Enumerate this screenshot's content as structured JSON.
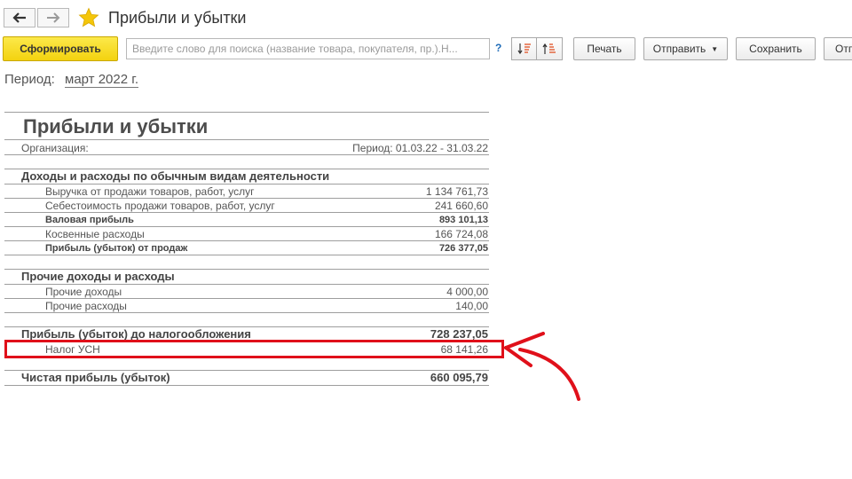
{
  "window": {
    "title": "Прибыли и убытки"
  },
  "toolbar": {
    "generate_label": "Сформировать",
    "search_placeholder": "Введите слово для поиска (название товара, покупателя, пр.).Н...",
    "help_label": "?",
    "print_label": "Печать",
    "send_label": "Отправить",
    "save_label": "Сохранить",
    "more_label": "Отп"
  },
  "period": {
    "label": "Период:",
    "value": "март 2022 г."
  },
  "report": {
    "title": "Прибыли и убытки",
    "org_label": "Организация:",
    "period_text": "Период: 01.03.22 - 31.03.22",
    "rows": [
      {
        "label": "Доходы и расходы по обычным видам деятельности",
        "value": ""
      },
      {
        "label": "Выручка от продажи товаров, работ, услуг",
        "value": "1 134 761,73"
      },
      {
        "label": "Себестоимость продажи товаров, работ, услуг",
        "value": "241 660,60"
      },
      {
        "label": "Валовая прибыль",
        "value": "893 101,13"
      },
      {
        "label": "Косвенные расходы",
        "value": "166 724,08"
      },
      {
        "label": "Прибыль (убыток) от продаж",
        "value": "726 377,05"
      },
      {
        "label": "Прочие доходы и расходы",
        "value": ""
      },
      {
        "label": "Прочие доходы",
        "value": "4 000,00"
      },
      {
        "label": "Прочие расходы",
        "value": "140,00"
      },
      {
        "label": "Прибыль (убыток) до налогообложения",
        "value": "728 237,05"
      },
      {
        "label": "Налог УСН",
        "value": "68 141,26"
      },
      {
        "label": "Чистая прибыль (убыток)",
        "value": "660 095,79"
      }
    ]
  },
  "colors": {
    "accent_yellow": "#f5d51a",
    "highlight_red": "#e0101a",
    "link_blue": "#1e6bb8",
    "star_yellow": "#f4c60a"
  },
  "icons": {
    "back": "arrow-left-icon",
    "forward": "arrow-right-icon",
    "favorite": "star-icon",
    "sort_desc": "sort-descending-icon",
    "sort_asc": "sort-ascending-icon",
    "dropdown": "chevron-down-icon",
    "annotation": "red-arrow-icon"
  }
}
